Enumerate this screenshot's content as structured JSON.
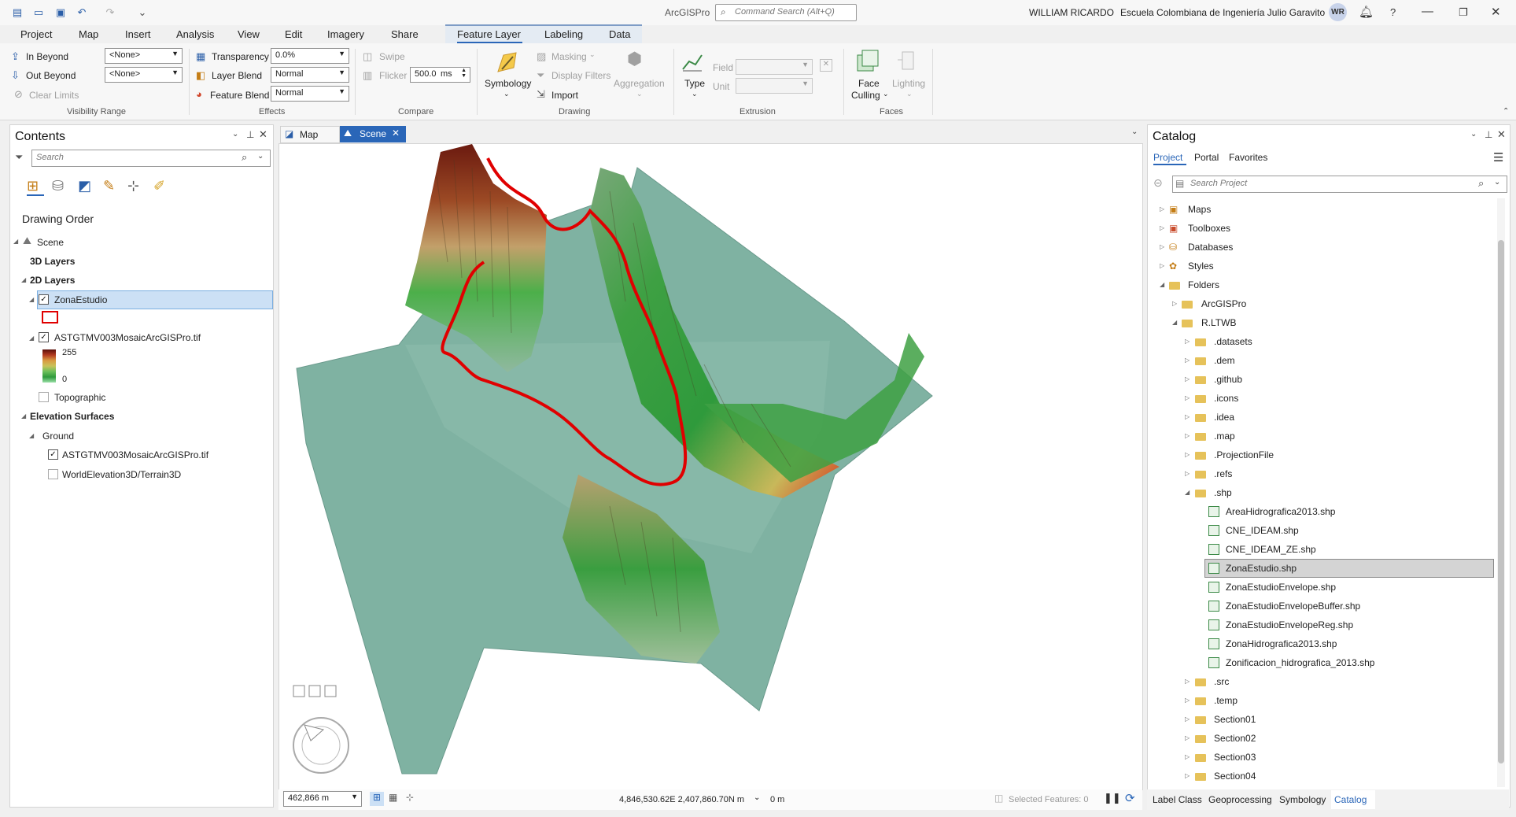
{
  "window": {
    "app_name": "ArcGISPro",
    "user_name": "WILLIAM RICARDO",
    "org": "Escuela Colombiana de Ingeniería Julio Garavito",
    "avatar": "WR",
    "command_search_placeholder": "Command Search (Alt+Q)"
  },
  "ribbon": {
    "tabs": [
      "Project",
      "Map",
      "Insert",
      "Analysis",
      "View",
      "Edit",
      "Imagery",
      "Share",
      "Feature Layer",
      "Labeling",
      "Data"
    ],
    "active_tab": "Feature Layer",
    "visibility": {
      "in_beyond": "In Beyond",
      "out_beyond": "Out Beyond",
      "clear_limits": "Clear Limits",
      "in_value": "<None>",
      "out_value": "<None>",
      "group": "Visibility Range"
    },
    "effects": {
      "transparency": "Transparency",
      "transparency_value": "0.0%",
      "layer_blend": "Layer Blend",
      "layer_blend_value": "Normal",
      "feature_blend": "Feature Blend",
      "feature_blend_value": "Normal",
      "group": "Effects"
    },
    "compare": {
      "swipe": "Swipe",
      "flicker": "Flicker",
      "flicker_value": "500.0",
      "flicker_unit": "ms",
      "group": "Compare"
    },
    "drawing": {
      "symbology": "Symbology",
      "masking": "Masking",
      "display_filters": "Display Filters",
      "import": "Import",
      "aggregation": "Aggregation",
      "group": "Drawing"
    },
    "extrusion": {
      "type": "Type",
      "field": "Field",
      "unit": "Unit",
      "group": "Extrusion"
    },
    "faces": {
      "face": "Face",
      "culling": "Culling",
      "lighting": "Lighting",
      "group": "Faces"
    }
  },
  "contents": {
    "title": "Contents",
    "search_placeholder": "Search",
    "drawing_order": "Drawing Order",
    "items": {
      "scene": "Scene",
      "layers_3d": "3D Layers",
      "layers_2d": "2D Layers",
      "zona_estudio": "ZonaEstudio",
      "raster": "ASTGTMV003MosaicArcGISPro.tif",
      "legend_high": "255",
      "legend_low": "0",
      "topographic": "Topographic",
      "elevation_surfaces": "Elevation Surfaces",
      "ground": "Ground",
      "ground_raster": "ASTGTMV003MosaicArcGISPro.tif",
      "world_elevation": "WorldElevation3D/Terrain3D"
    }
  },
  "view": {
    "tabs": [
      "Map",
      "Scene"
    ],
    "active_tab": "Scene",
    "scale": "462,866 m",
    "coordinates": "4,846,530.62E 2,407,860.70N m",
    "elevation": "0 m",
    "selected_features": "Selected Features: 0"
  },
  "catalog": {
    "title": "Catalog",
    "tabs": [
      "Project",
      "Portal",
      "Favorites"
    ],
    "active_tab": "Project",
    "search_placeholder": "Search Project",
    "top_items": [
      "Maps",
      "Toolboxes",
      "Databases",
      "Styles",
      "Folders"
    ],
    "folders": [
      "ArcGISPro",
      "R.LTWB"
    ],
    "rltwb_items": [
      ".datasets",
      ".dem",
      ".github",
      ".icons",
      ".idea",
      ".map",
      ".ProjectionFile",
      ".refs",
      ".shp"
    ],
    "shp_files": [
      "AreaHidrografica2013.shp",
      "CNE_IDEAM.shp",
      "CNE_IDEAM_ZE.shp",
      "ZonaEstudio.shp",
      "ZonaEstudioEnvelope.shp",
      "ZonaEstudioEnvelopeBuffer.shp",
      "ZonaEstudioEnvelopeReg.shp",
      "ZonaHidrografica2013.shp",
      "Zonificacion_hidrografica_2013.shp"
    ],
    "selected_file": "ZonaEstudio.shp",
    "after_items": [
      ".src",
      ".temp",
      "Section01",
      "Section02",
      "Section03",
      "Section04"
    ],
    "bottom_tabs": [
      "Label Class",
      "Geoprocessing",
      "Symbology",
      "Catalog"
    ],
    "active_bottom_tab": "Catalog"
  },
  "colors": {
    "accent": "#2a66b8",
    "boundary": "#e00000",
    "terrain_base": "#7fb2a2",
    "selection": "#cce0f5"
  }
}
